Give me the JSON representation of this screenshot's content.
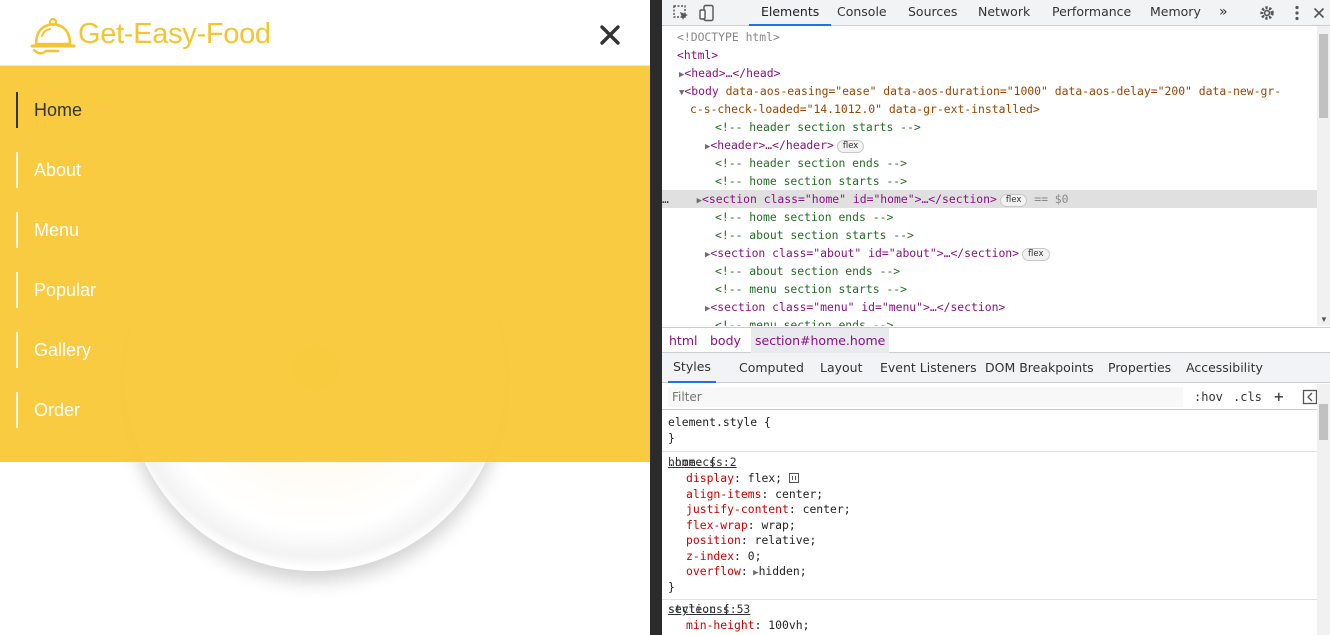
{
  "site": {
    "brand": "Get-Easy-Food",
    "nav": [
      "Home",
      "About",
      "Menu",
      "Popular",
      "Gallery",
      "Order"
    ],
    "colors": {
      "accent": "#f4c531",
      "overlay": "#f8c733"
    }
  },
  "devtools": {
    "tabs": [
      "Elements",
      "Console",
      "Sources",
      "Network",
      "Performance",
      "Memory"
    ],
    "overflow": "»",
    "dom": {
      "doctype": "<!DOCTYPE html>",
      "html": "<html>",
      "head": "<head>…</head>",
      "body_open": "<body",
      "body_attrs_1": " data-aos-easing=\"ease\" data-aos-duration=\"1000\" data-aos-delay=\"200\" data-new-gr-",
      "body_attrs_2": "c-s-check-loaded=\"14.1012.0\" data-gr-ext-installed>",
      "comments": [
        "<!-- header section starts -->",
        "<!-- header section ends -->",
        "<!-- home section starts -->",
        "<!-- home section ends -->",
        "<!-- about section starts -->",
        "<!-- about section ends -->",
        "<!-- menu section starts -->",
        "<!-- menu section ends -->"
      ],
      "header": "<header>…</header>",
      "section_home": "<section class=\"home\" id=\"home\">…</section>",
      "section_about": "<section class=\"about\" id=\"about\">…</section>",
      "section_menu": "<section class=\"menu\" id=\"menu\">…</section>",
      "badge": "flex",
      "selected_marker": "== $0",
      "dots": "…"
    },
    "breadcrumbs": [
      "html",
      "body",
      "section#home.home"
    ],
    "subtabs": [
      "Styles",
      "Computed",
      "Layout",
      "Event Listeners",
      "DOM Breakpoints",
      "Properties",
      "Accessibility"
    ],
    "filter": {
      "placeholder": "Filter",
      "hov": ":hov",
      "cls": ".cls",
      "plus": "+"
    },
    "styles": {
      "element_style": "element.style {",
      "close": "}",
      "home_selector": ".home {",
      "home_source": "home.css:2",
      "home_props": [
        {
          "p": "display",
          "v": "flex;"
        },
        {
          "p": "align-items",
          "v": "center;"
        },
        {
          "p": "justify-content",
          "v": "center;"
        },
        {
          "p": "flex-wrap",
          "v": "wrap;"
        },
        {
          "p": "position",
          "v": "relative;"
        },
        {
          "p": "z-index",
          "v": "0;"
        },
        {
          "p": "overflow",
          "v": "hidden;"
        }
      ],
      "section_selector": "section {",
      "section_source": "style.css:53",
      "section_props": [
        {
          "p": "min-height",
          "v": "100vh;"
        }
      ]
    }
  }
}
